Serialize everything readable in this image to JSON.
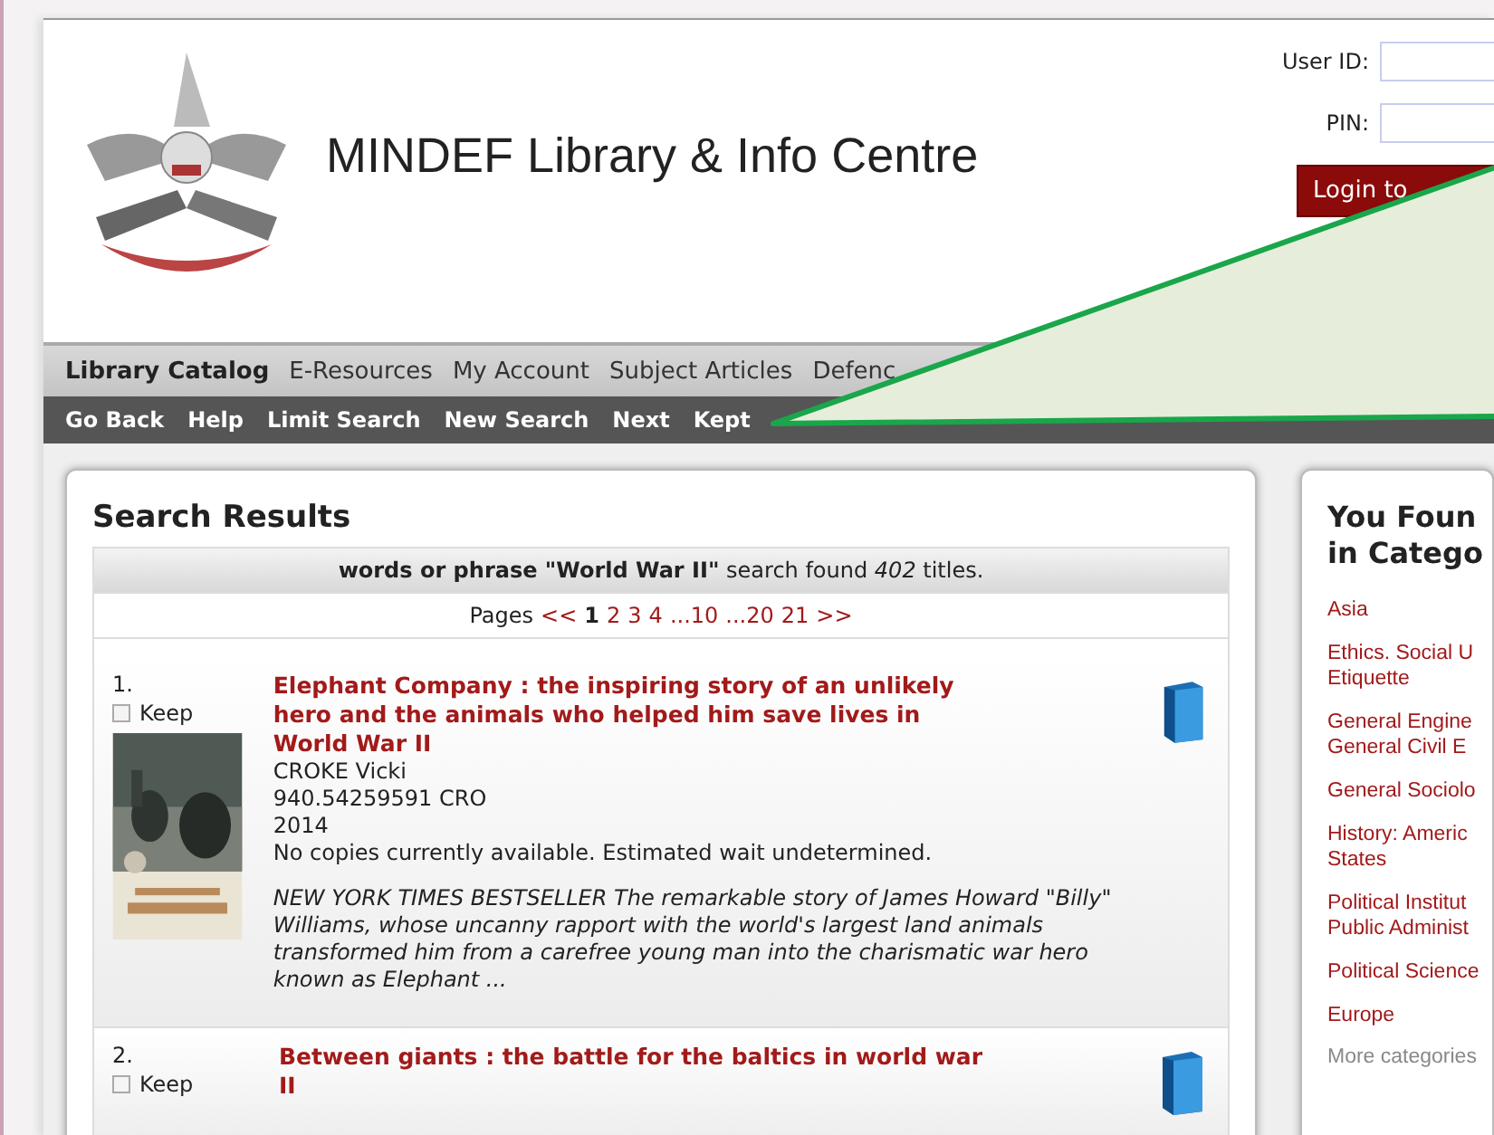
{
  "header": {
    "title": "MINDEF Library & Info Centre",
    "login": {
      "user_label": "User ID:",
      "pin_label": "PIN:",
      "button": "Login to"
    }
  },
  "nav_primary": [
    {
      "label": "Library Catalog",
      "selected": true
    },
    {
      "label": "E-Resources",
      "selected": false
    },
    {
      "label": "My Account",
      "selected": false
    },
    {
      "label": "Subject Articles",
      "selected": false
    },
    {
      "label": "Defenc",
      "selected": false
    }
  ],
  "nav_secondary": [
    "Go Back",
    "Help",
    "Limit Search",
    "New Search",
    "Next",
    "Kept"
  ],
  "search_results": {
    "heading": "Search Results",
    "summary": "**words or phrase \"World War II\"** search found *402* titles.",
    "pages_label": "Pages",
    "pages": [
      {
        "label": "<<",
        "selected": false
      },
      {
        "label": "1",
        "selected": true
      },
      {
        "label": "2",
        "selected": false
      },
      {
        "label": "3",
        "selected": false
      },
      {
        "label": "4",
        "selected": false
      },
      {
        "label": "...10",
        "selected": false
      },
      {
        "label": "...20",
        "selected": false
      },
      {
        "label": "21",
        "selected": false
      },
      {
        "label": ">>",
        "selected": false
      }
    ],
    "results": [
      {
        "number": "1.",
        "keep_label": "Keep",
        "kept": false,
        "title": "Elephant Company : the inspiring story of an unlikely hero and the animals who helped him save lives in World War II",
        "author": "CROKE Vicki",
        "call_number": "940.54259591 CRO",
        "year": "2014",
        "availability": "No copies currently available. Estimated wait undetermined.",
        "summary": "NEW YORK TIMES BESTSELLER The remarkable story of James Howard \"Billy\" Williams, whose uncanny rapport with the world's largest land animals transformed him from a carefree young man into the charismatic war hero known as Elephant ..."
      },
      {
        "number": "2.",
        "keep_label": "Keep",
        "kept": false,
        "title": "Between giants : the battle for the baltics in world war II"
      }
    ]
  },
  "categories": {
    "heading": [
      "You Foun",
      "in Catego"
    ],
    "items": [
      [
        "Asia"
      ],
      [
        "Ethics. Social U",
        "Etiquette"
      ],
      [
        "General Engine",
        "General Civil E"
      ],
      [
        "General Sociolo"
      ],
      [
        "History: Americ",
        "States"
      ],
      [
        "Political Institut",
        "Public Administ"
      ],
      [
        "Political Science"
      ],
      [
        "Europe"
      ]
    ],
    "more": "More categories"
  }
}
